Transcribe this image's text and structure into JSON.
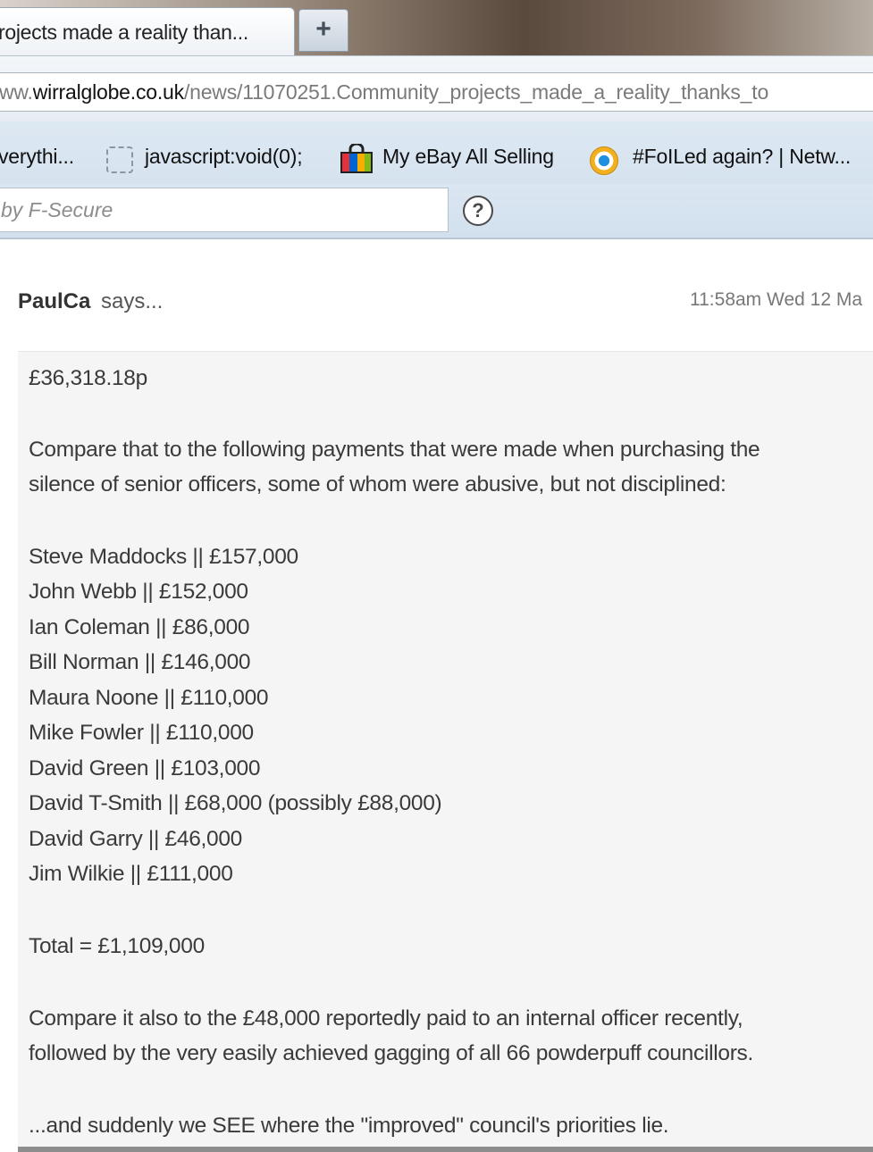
{
  "browser": {
    "tab_title": "rojects made a reality than...",
    "new_tab_label": "+",
    "url_prefix": "ww.",
    "url_domain": "wirralglobe.co.uk",
    "url_path": "/news/11070251.Community_projects_made_a_reality_thanks_to",
    "bookmarks": [
      {
        "label": "verythi...",
        "icon": "none"
      },
      {
        "label": "javascript:void(0);",
        "icon": "blank-page-icon"
      },
      {
        "label": "My eBay All Selling",
        "icon": "shopping-bag-icon"
      },
      {
        "label": "#FoILed again? | Netw...",
        "icon": "globe-circle-icon"
      }
    ],
    "search_placeholder": "by F-Secure",
    "help_icon": "?"
  },
  "comment": {
    "author": "PaulCa",
    "says": "says...",
    "timestamp": "11:58am Wed 12 Ma",
    "amount": "£36,318.18p",
    "intro_line1": "Compare that to the following payments that were made when purchasing the",
    "intro_line2": "silence of senior officers, some of whom were abusive, but not disciplined:",
    "payments": [
      "Steve Maddocks || £157,000",
      "John Webb || £152,000",
      "Ian Coleman || £86,000",
      "Bill Norman || £146,000",
      "Maura Noone || £110,000",
      "Mike Fowler || £110,000",
      "David Green || £103,000",
      "David T-Smith || £68,000 (possibly £88,000)",
      "David Garry || £46,000",
      "Jim Wilkie || £111,000"
    ],
    "total": "Total = £1,109,000",
    "compare_line1": "Compare it also to the £48,000 reportedly paid to an internal officer recently,",
    "compare_line2": "followed by the very easily achieved gagging of all 66 powderpuff councillors.",
    "closing": "...and suddenly we SEE where the \"improved\" council's priorities lie."
  }
}
